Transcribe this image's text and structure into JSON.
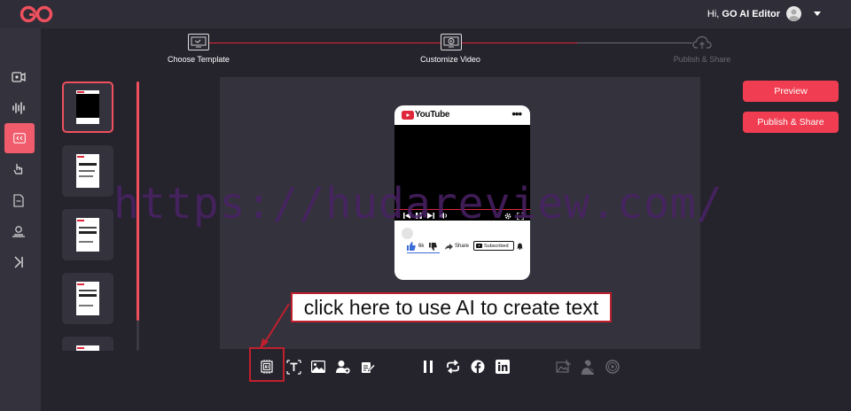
{
  "header": {
    "logo": "GO",
    "greeting_prefix": "Hi, ",
    "user_name": "GO AI Editor"
  },
  "sidebar": {
    "items": [
      {
        "icon": "video-icon"
      },
      {
        "icon": "audio-wave-icon"
      },
      {
        "icon": "subtitle-icon",
        "active": true
      },
      {
        "icon": "pointer-hand-icon"
      },
      {
        "icon": "document-icon"
      },
      {
        "icon": "user-badge-icon"
      },
      {
        "icon": "skip-forward-icon"
      }
    ]
  },
  "stepper": {
    "steps": [
      {
        "label": "Choose Template",
        "state": "done"
      },
      {
        "label": "Customize Video",
        "state": "current"
      },
      {
        "label": "Publish & Share",
        "state": "pending"
      }
    ]
  },
  "actions": {
    "preview_label": "Preview",
    "publish_label": "Publish & Share"
  },
  "preview": {
    "brand": "YouTube",
    "like_count": "6k",
    "share_label": "Share",
    "subscribed_label": "Subscribed"
  },
  "watermark": "https://hudareview.com/",
  "callout": "click here to use AI to create text",
  "toolbar": {
    "icons": [
      "ai-text-icon",
      "text-icon",
      "image-icon",
      "add-person-icon",
      "edit-document-icon",
      "pause-icon",
      "loop-icon",
      "facebook-icon",
      "linkedin-icon",
      "crop-image-icon",
      "remove-person-icon",
      "play-circle-icon"
    ]
  },
  "colors": {
    "accent": "#f03d51",
    "background": "#25232c",
    "panel": "#34323c",
    "callout_border": "#c0202e"
  }
}
